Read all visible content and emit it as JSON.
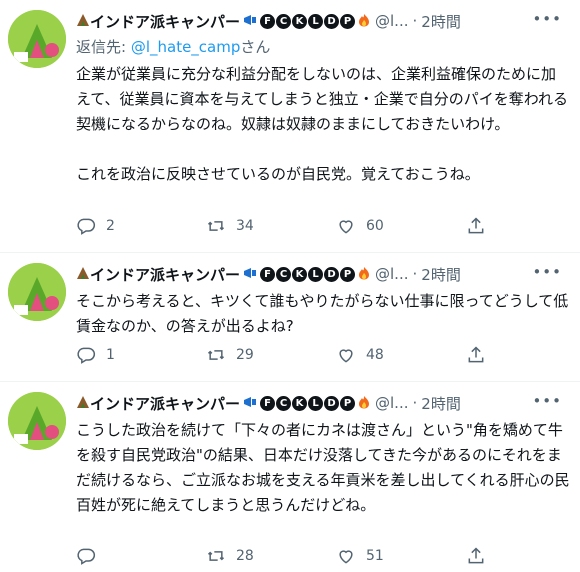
{
  "tweets": [
    {
      "author_name": "インドア派キャンパー",
      "circle_letters": [
        "F",
        "C",
        "K",
        "L",
        "D",
        "P"
      ],
      "handle": "@l...",
      "time": "2時間",
      "reply_prefix": "返信先: ",
      "reply_handle": "@l_hate_camp",
      "reply_suffix": "さん",
      "text": "企業が従業員に充分な利益分配をしないのは、企業利益確保のために加えて、従業員に資本を与えてしまうと独立・企業で自分のパイを奪われる契機になるからなのね。奴隷は奴隷のままにしておきたいわけ。\n\nこれを政治に反映させているのが自民党。覚えておこうね。",
      "replies": "2",
      "retweets": "34",
      "likes": "60"
    },
    {
      "author_name": "インドア派キャンパー",
      "circle_letters": [
        "F",
        "C",
        "K",
        "L",
        "D",
        "P"
      ],
      "handle": "@l...",
      "time": "2時間",
      "text": "そこから考えると、キツくて誰もやりたがらない仕事に限ってどうして低賃金なのか、の答えが出るよね?",
      "replies": "1",
      "retweets": "29",
      "likes": "48"
    },
    {
      "author_name": "インドア派キャンパー",
      "circle_letters": [
        "F",
        "C",
        "K",
        "L",
        "D",
        "P"
      ],
      "handle": "@l...",
      "time": "2時間",
      "text": "こうした政治を続けて「下々の者にカネは渡さん」という\"角を矯めて牛を殺す自民党政治\"の結果、日本だけ没落してきた今があるのにそれをまだ続けるなら、ご立派なお城を支える年貢米を差し出してくれる肝心の民百姓が死に絶えてしまうと思うんだけどね。",
      "replies": "",
      "retweets": "28",
      "likes": "51"
    }
  ],
  "more_icon": "ellipsis-icon",
  "colors": {
    "text": "#0f1419",
    "muted": "#536471",
    "link": "#1d9bf0",
    "divider": "#eff3f4"
  }
}
